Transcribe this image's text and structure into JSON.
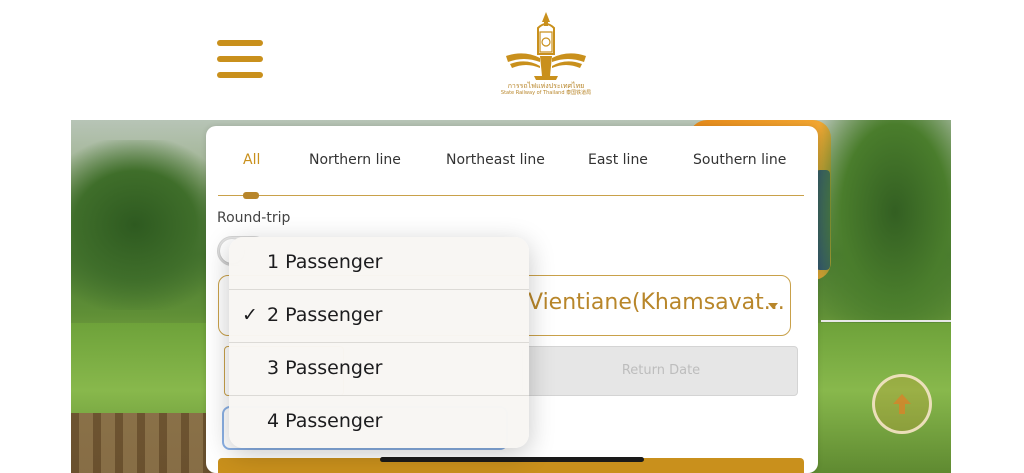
{
  "header": {
    "menu_icon": "hamburger-icon",
    "logo_icon": "srt-emblem-icon",
    "logo_text_th": "การรถไฟแห่งประเทศไทย",
    "logo_text_en": "State Railway of Thailand 泰国铁道局"
  },
  "tabs": [
    {
      "label": "All",
      "active": true
    },
    {
      "label": "Northern line",
      "active": false
    },
    {
      "label": "Northeast line",
      "active": false
    },
    {
      "label": "East line",
      "active": false
    },
    {
      "label": "Southern line",
      "active": false
    }
  ],
  "form": {
    "round_trip_label": "Round-trip",
    "round_trip_on": false,
    "destination_value": "Vientiane(Khamsavat...",
    "return_date_placeholder": "Return Date"
  },
  "passenger_menu": {
    "selected_index": 1,
    "options": [
      "1 Passenger",
      "2 Passenger",
      "3 Passenger",
      "4 Passenger"
    ],
    "check_glyph": "✓"
  },
  "colors": {
    "accent": "#c9901c",
    "gold_text": "#b8862a",
    "border_gold": "#c9a14a",
    "focus_blue": "#8bb1e6"
  },
  "scroll_top_icon": "arrow-up-icon"
}
